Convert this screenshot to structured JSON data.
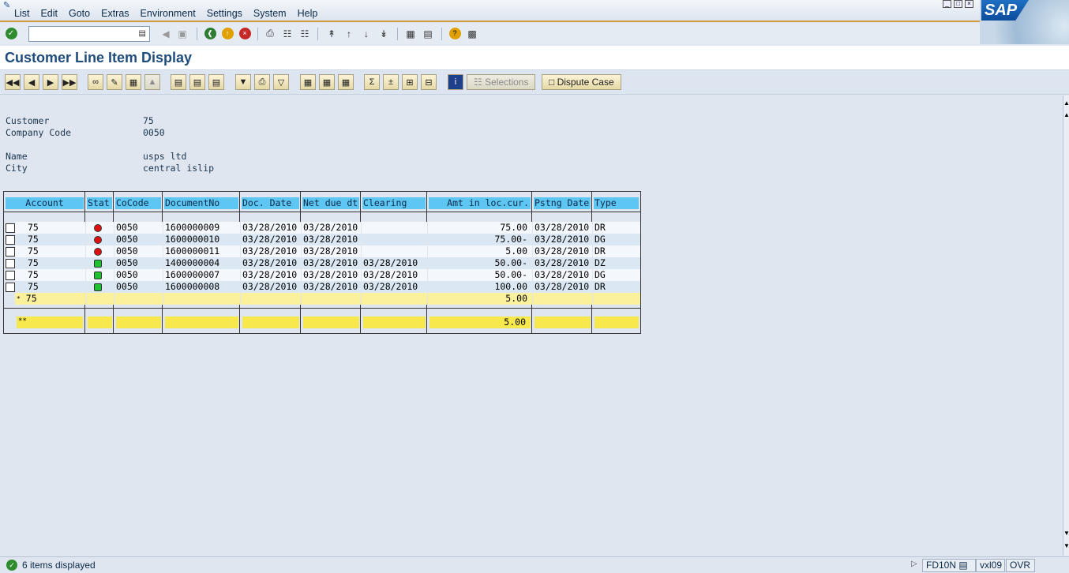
{
  "menu": [
    "List",
    "Edit",
    "Goto",
    "Extras",
    "Environment",
    "Settings",
    "System",
    "Help"
  ],
  "title": "Customer Line Item Display",
  "app_toolbar": {
    "selections": "Selections",
    "dispute": "Dispute Case"
  },
  "header_info": {
    "customer_label": "Customer",
    "customer_value": "75",
    "company_label": "Company Code",
    "company_value": "0050",
    "name_label": "Name",
    "name_value": "usps ltd",
    "city_label": "City",
    "city_value": "central islip"
  },
  "columns": [
    "Account",
    "Stat",
    "CoCode",
    "DocumentNo",
    "Doc. Date",
    "Net due dt",
    "Clearing",
    "Amt in loc.cur.",
    "Pstng Date",
    "Type"
  ],
  "rows": [
    {
      "account": "75",
      "status": "red",
      "cocode": "0050",
      "docno": "1600000009",
      "docdate": "03/28/2010",
      "netdue": "03/28/2010",
      "clearing": "",
      "amount": "75.00",
      "pstng": "03/28/2010",
      "type": "DR"
    },
    {
      "account": "75",
      "status": "red",
      "cocode": "0050",
      "docno": "1600000010",
      "docdate": "03/28/2010",
      "netdue": "03/28/2010",
      "clearing": "",
      "amount": "75.00-",
      "pstng": "03/28/2010",
      "type": "DG"
    },
    {
      "account": "75",
      "status": "red",
      "cocode": "0050",
      "docno": "1600000011",
      "docdate": "03/28/2010",
      "netdue": "03/28/2010",
      "clearing": "",
      "amount": "5.00",
      "pstng": "03/28/2010",
      "type": "DR"
    },
    {
      "account": "75",
      "status": "green",
      "cocode": "0050",
      "docno": "1400000004",
      "docdate": "03/28/2010",
      "netdue": "03/28/2010",
      "clearing": "03/28/2010",
      "amount": "50.00-",
      "pstng": "03/28/2010",
      "type": "DZ"
    },
    {
      "account": "75",
      "status": "green",
      "cocode": "0050",
      "docno": "1600000007",
      "docdate": "03/28/2010",
      "netdue": "03/28/2010",
      "clearing": "03/28/2010",
      "amount": "50.00-",
      "pstng": "03/28/2010",
      "type": "DG"
    },
    {
      "account": "75",
      "status": "green",
      "cocode": "0050",
      "docno": "1600000008",
      "docdate": "03/28/2010",
      "netdue": "03/28/2010",
      "clearing": "03/28/2010",
      "amount": "100.00",
      "pstng": "03/28/2010",
      "type": "DR"
    }
  ],
  "subtotal": {
    "marker": "*",
    "account": "75",
    "amount": "5.00"
  },
  "total": {
    "marker": "**",
    "amount": "5.00"
  },
  "status": {
    "message": "6 items displayed",
    "transaction": "FD10N",
    "server": "vxl09",
    "mode": "OVR"
  },
  "logo_text": "SAP"
}
